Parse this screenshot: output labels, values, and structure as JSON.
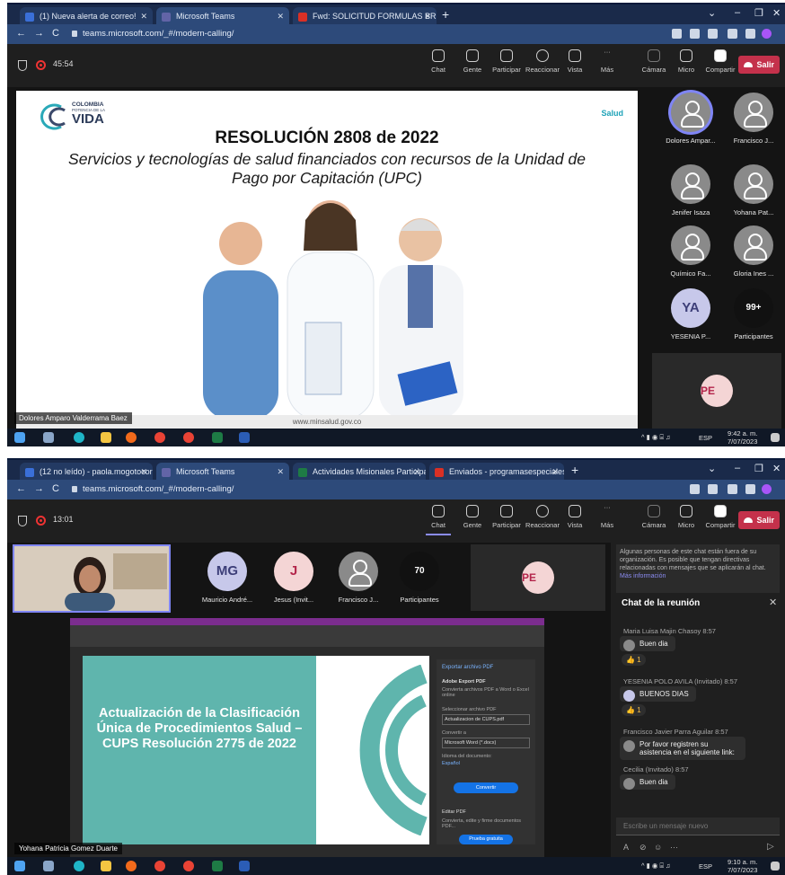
{
  "s1": {
    "tabs": [
      "(1) Nueva alerta de correo!",
      "Microsoft Teams",
      "Fwd: SOLICITUD FORMULAS BRI"
    ],
    "url": "teams.microsoft.com/_#/modern-calling/",
    "timer": "45:54",
    "toolbar": [
      "Chat",
      "Gente",
      "Participar",
      "Reaccionar",
      "Vista",
      "Más",
      "Cámara",
      "Micro",
      "Compartir"
    ],
    "leave": "Salir",
    "slide": {
      "logo_top": "COLOMBIA",
      "logo_mid": "POTENCIA DE LA",
      "logo_main": "VIDA",
      "brand": "Salud",
      "title": "RESOLUCIÓN 2808 de 2022",
      "subtitle": "Servicios y tecnologías de salud financiados con recursos de la Unidad de Pago por Capitación (UPC)",
      "footer": "www.minsalud.gov.co"
    },
    "participants": [
      "Dolores Ampar...",
      "Francisco J...",
      "Jenifer Isaza",
      "Yohana Pat...",
      "Químico Fa...",
      "Gloria Ines ...",
      "YESENIA P...",
      "Participantes"
    ],
    "ya": "YA",
    "more": "99+",
    "pe": "PE",
    "presenter": "Dolores Amparo Valderrama Baez",
    "clock": "9:42 a. m.",
    "date": "7/07/2023",
    "lang": "ESP"
  },
  "s2": {
    "tabs": [
      "(12 no leído) - paola.mogotocoro",
      "Microsoft Teams",
      "Actividades Misionales Participa",
      "Enviados - programasespeciales"
    ],
    "url": "teams.microsoft.com/_#/modern-calling/",
    "timer": "13:01",
    "toolbar": [
      "Chat",
      "Gente",
      "Participar",
      "Reaccionar",
      "Vista",
      "Más",
      "Cámara",
      "Micro",
      "Compartir"
    ],
    "leave": "Salir",
    "participants": [
      "Mauricio André...",
      "Jesus (Invit...",
      "Francisco J...",
      "Participantes"
    ],
    "mg": "MG",
    "j": "J",
    "count": "70",
    "pe": "PE",
    "notice": "Algunas personas de este chat están fuera de su organización. Es posible que tengan directivas relacionadas con mensajes que se aplicarán al chat.",
    "notice_link": "Más información",
    "chat_title": "Chat de la reunión",
    "messages": [
      {
        "who": "Maria Luisa Majin Chasoy  8:57",
        "text": "Buen dia",
        "r": "👍 1"
      },
      {
        "who": "YESENIA POLO AVILA (Invitado)  8:57",
        "text": "BUENOS DIAS",
        "r": "👍 1"
      },
      {
        "who": "Francisco Javier Parra Aguilar  8:57",
        "text": "Por favor registren su asistencia en el siguiente link:"
      },
      {
        "who": "Cecilia (Invitado)  8:57",
        "text": "Buen dia"
      }
    ],
    "input_ph": "Escribe un mensaje nuevo",
    "slide": {
      "title": "Actualización de la Clasificación Única de Procedimientos Salud – CUPS Resolución 2775 de 2022"
    },
    "pdf": {
      "panel_title": "Exportar archivo PDF",
      "adobe": "Adobe Export PDF",
      "desc": "Convierta archivos PDF a Word o Excel online",
      "sel": "Seleccionar archivo PDF",
      "file": "Actualizacion de CUPS.pdf",
      "conv": "Convertir a",
      "fmt": "Microsoft Word (*.docx)",
      "lang": "Idioma del documento:",
      "lang_v": "Español",
      "btn": "Convertir",
      "edit": "Editar PDF",
      "edit_d": "Convierta, edite y firme documentos PDF...",
      "trial": "Prueba gratuita"
    },
    "presenter": "Yohana Patricia Gomez Duarte",
    "clock": "9:10 a. m.",
    "date": "7/07/2023",
    "lang": "ESP"
  }
}
